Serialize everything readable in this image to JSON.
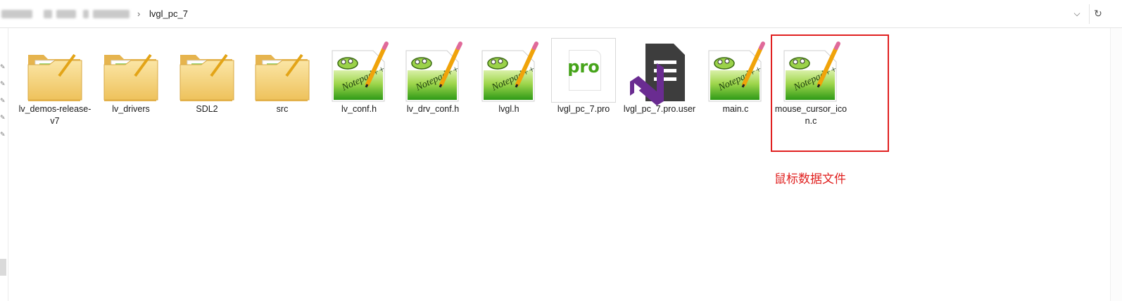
{
  "address_bar": {
    "current_folder": "lvgl_pc_7",
    "separator": "›",
    "dropdown_glyph": "⌵",
    "refresh_glyph": "↻"
  },
  "files": [
    {
      "name": "lv_demos-release-v7",
      "icon": "folder-icon"
    },
    {
      "name": "lv_drivers",
      "icon": "folder-icon"
    },
    {
      "name": "SDL2",
      "icon": "folder-icon"
    },
    {
      "name": "src",
      "icon": "folder-icon"
    },
    {
      "name": "lv_conf.h",
      "icon": "notepad-plus-plus-icon"
    },
    {
      "name": "lv_drv_conf.h",
      "icon": "notepad-plus-plus-icon"
    },
    {
      "name": "lvgl.h",
      "icon": "notepad-plus-plus-icon"
    },
    {
      "name": "lvgl_pc_7.pro",
      "icon": "qt-pro-file-icon",
      "badge": "pro"
    },
    {
      "name": "lvgl_pc_7.pro.user",
      "icon": "visual-studio-file-icon"
    },
    {
      "name": "main.c",
      "icon": "notepad-plus-plus-icon"
    },
    {
      "name": "mouse_cursor_icon.c",
      "icon": "notepad-plus-plus-icon"
    }
  ],
  "annotation": {
    "text": "鼠标数据文件",
    "color": "#e02020"
  },
  "colors": {
    "folder": "#f5d27a",
    "grass": "#3fae1f",
    "pro_badge": "#46a41a",
    "vs_purple": "#6a2c91"
  }
}
